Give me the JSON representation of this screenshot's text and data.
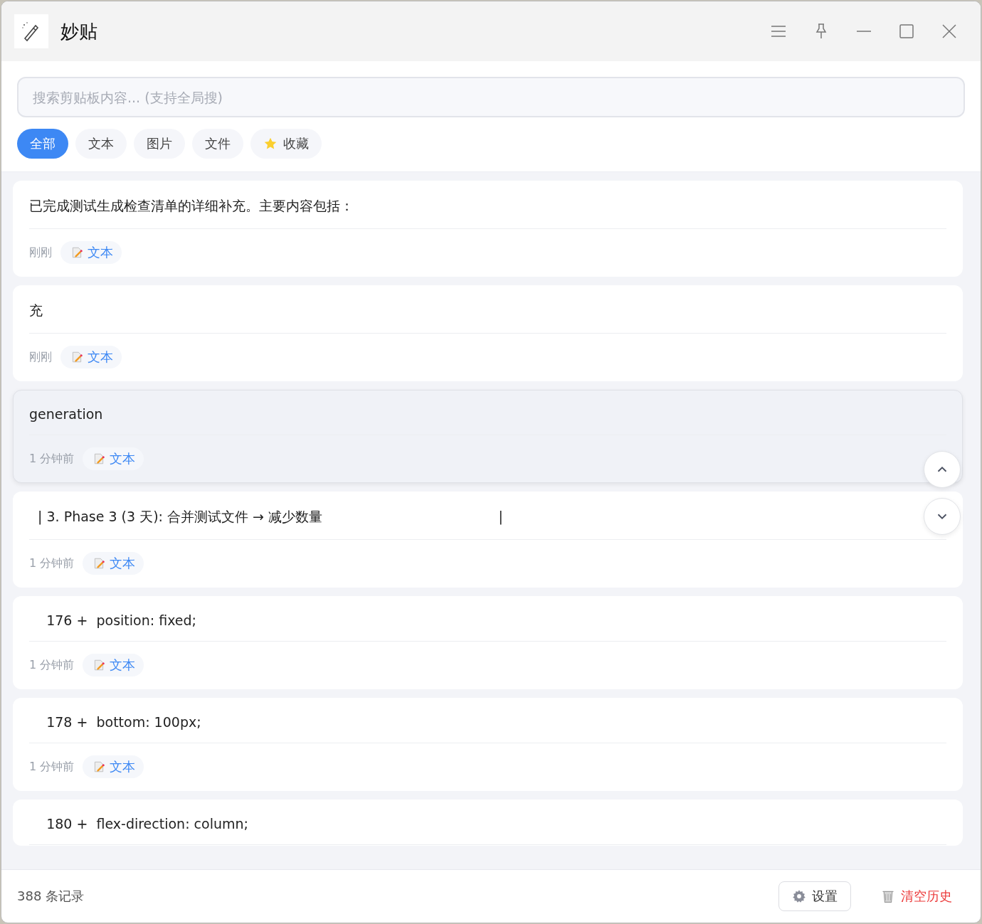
{
  "window": {
    "title": "妙贴"
  },
  "search": {
    "placeholder": "搜索剪贴板内容... (支持全局搜)"
  },
  "tabs": [
    {
      "label": "全部",
      "selected": true,
      "kind": "plain"
    },
    {
      "label": "文本",
      "selected": false,
      "kind": "plain"
    },
    {
      "label": "图片",
      "selected": false,
      "kind": "plain"
    },
    {
      "label": "文件",
      "selected": false,
      "kind": "plain"
    },
    {
      "label": "收藏",
      "selected": false,
      "kind": "star"
    }
  ],
  "items": [
    {
      "content": "已完成测试生成检查清单的详细补充。主要内容包括：",
      "time": "刚刚",
      "type": "文本",
      "hovered": false
    },
    {
      "content": "充",
      "time": "刚刚",
      "type": "文本",
      "hovered": false
    },
    {
      "content": "generation",
      "time": "1 分钟前",
      "type": "文本",
      "hovered": true
    },
    {
      "content": "  | 3. Phase 3 (3 天): 合并测试文件 → 减少数量                                         |",
      "time": "1 分钟前",
      "type": "文本",
      "hovered": false
    },
    {
      "content": "    176 +  position: fixed;",
      "time": "1 分钟前",
      "type": "文本",
      "hovered": false
    },
    {
      "content": "    178 +  bottom: 100px;",
      "time": "1 分钟前",
      "type": "文本",
      "hovered": false
    },
    {
      "content": "    180 +  flex-direction: column;",
      "hovered": false
    }
  ],
  "status_bar": {
    "count": "388 条记录",
    "settings": "设置",
    "clear": "清空历史"
  }
}
